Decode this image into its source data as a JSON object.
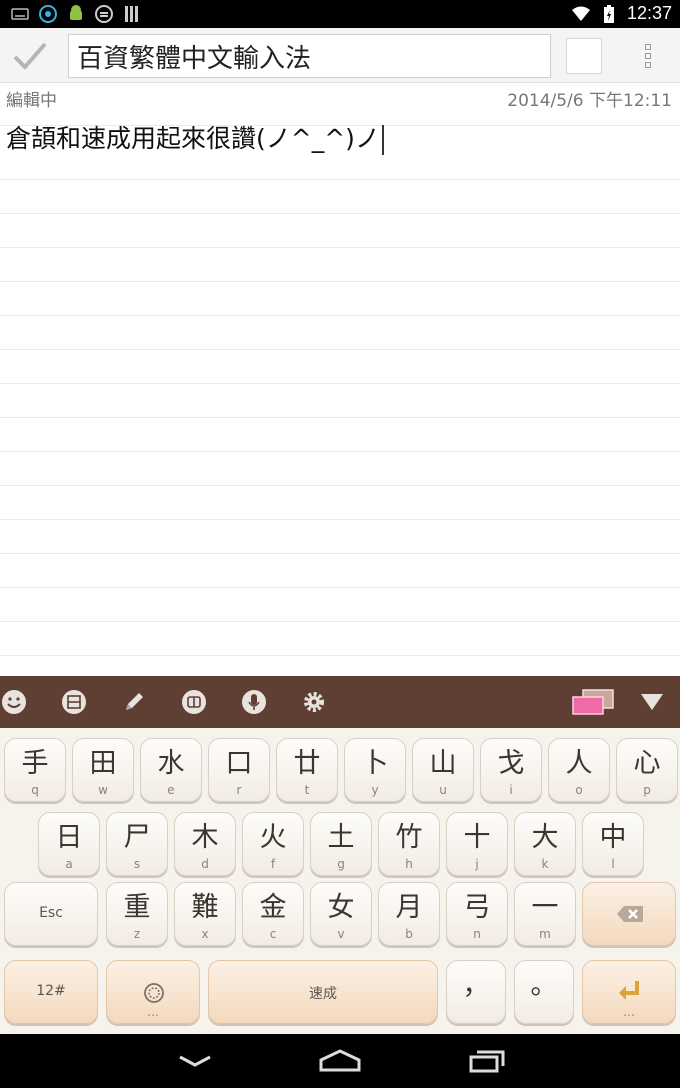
{
  "status_bar": {
    "time": "12:37",
    "icons": [
      "keyboard-icon",
      "sync-icon",
      "android-icon",
      "message-icon",
      "signal-bars-icon",
      "wifi-icon",
      "battery-icon"
    ]
  },
  "action_bar": {
    "title_value": "百資繁體中文輸入法"
  },
  "editor": {
    "status_label": "編輯中",
    "timestamp": "2014/5/6 下午12:11",
    "text": "倉頡和速成用起來很讚(ノ^_^)ノ"
  },
  "keyboard_toolbar": {
    "icons": [
      "emoji-icon",
      "phrase-icon",
      "handwriting-icon",
      "layout-icon",
      "microphone-icon",
      "settings-icon",
      "theme-color-icon",
      "hide-keyboard-icon"
    ]
  },
  "keyboard": {
    "row1": [
      {
        "main": "手",
        "sub": "q"
      },
      {
        "main": "田",
        "sub": "w"
      },
      {
        "main": "水",
        "sub": "e"
      },
      {
        "main": "口",
        "sub": "r"
      },
      {
        "main": "廿",
        "sub": "t"
      },
      {
        "main": "卜",
        "sub": "y"
      },
      {
        "main": "山",
        "sub": "u"
      },
      {
        "main": "戈",
        "sub": "i"
      },
      {
        "main": "人",
        "sub": "o"
      },
      {
        "main": "心",
        "sub": "p"
      }
    ],
    "row2": [
      {
        "main": "日",
        "sub": "a"
      },
      {
        "main": "尸",
        "sub": "s"
      },
      {
        "main": "木",
        "sub": "d"
      },
      {
        "main": "火",
        "sub": "f"
      },
      {
        "main": "土",
        "sub": "g"
      },
      {
        "main": "竹",
        "sub": "h"
      },
      {
        "main": "十",
        "sub": "j"
      },
      {
        "main": "大",
        "sub": "k"
      },
      {
        "main": "中",
        "sub": "l"
      }
    ],
    "row3": [
      {
        "main": "重",
        "sub": "z"
      },
      {
        "main": "難",
        "sub": "x"
      },
      {
        "main": "金",
        "sub": "c"
      },
      {
        "main": "女",
        "sub": "v"
      },
      {
        "main": "月",
        "sub": "b"
      },
      {
        "main": "弓",
        "sub": "n"
      },
      {
        "main": "一",
        "sub": "m"
      }
    ],
    "esc_label": "Esc",
    "symbols_label": "12#",
    "space_label": "速成",
    "comma_label": "，",
    "period_label": "。"
  },
  "nav_bar": {
    "icons": [
      "back-icon",
      "home-icon",
      "recent-apps-icon"
    ]
  }
}
